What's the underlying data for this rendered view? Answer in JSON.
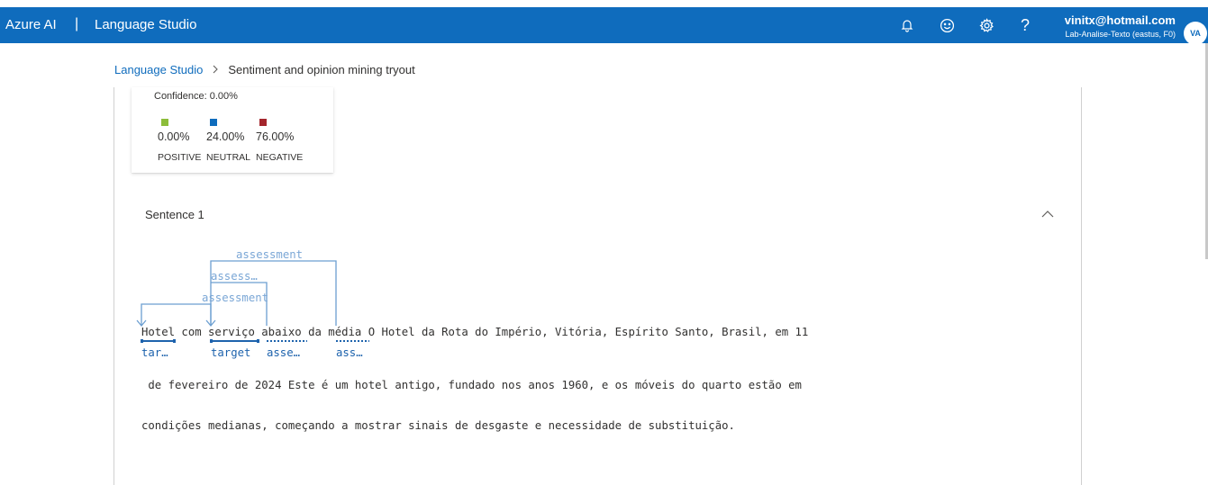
{
  "header": {
    "brand": "Azure AI",
    "separator": "|",
    "product": "Language Studio",
    "icons": [
      "bell-icon",
      "smiley-icon",
      "settings-icon",
      "help-icon"
    ],
    "account_email": "vinitx@hotmail.com",
    "account_resource": "Lab-Analise-Texto (eastus, F0)",
    "avatar_initials": "VA"
  },
  "breadcrumb": {
    "root": "Language Studio",
    "current": "Sentiment and opinion mining tryout"
  },
  "card": {
    "confidence": "Confidence: 0.00%",
    "scores": [
      {
        "value": "0.00%",
        "label": "POSITIVE",
        "color": "#8cbd3a"
      },
      {
        "value": "24.00%",
        "label": "NEUTRAL",
        "color": "#0f6cbd"
      },
      {
        "value": "76.00%",
        "label": "NEGATIVE",
        "color": "#a4262c"
      }
    ]
  },
  "sentence": {
    "title": "Sentence 1",
    "line1": "Hotel com serviço abaixo da média O Hotel da Rota do Império, Vitória, Espírito Santo, Brasil, em 11",
    "line2": " de fevereiro de 2024 Este é um hotel antigo, fundado nos anos 1960, e os móveis do quarto estão em",
    "line3": "condições medianas, começando a mostrar sinais de desgaste e necessidade de substituição.",
    "arc_labels": [
      "assessment",
      "assess…",
      "assessment"
    ],
    "token_labels": [
      "tar…",
      "target",
      "asse…",
      "ass…"
    ]
  },
  "colors": {
    "topbar": "#0f6cbd",
    "link": "#0f6cbd",
    "arc": "#6c9fd1",
    "token_underline": "#1e63ad"
  }
}
